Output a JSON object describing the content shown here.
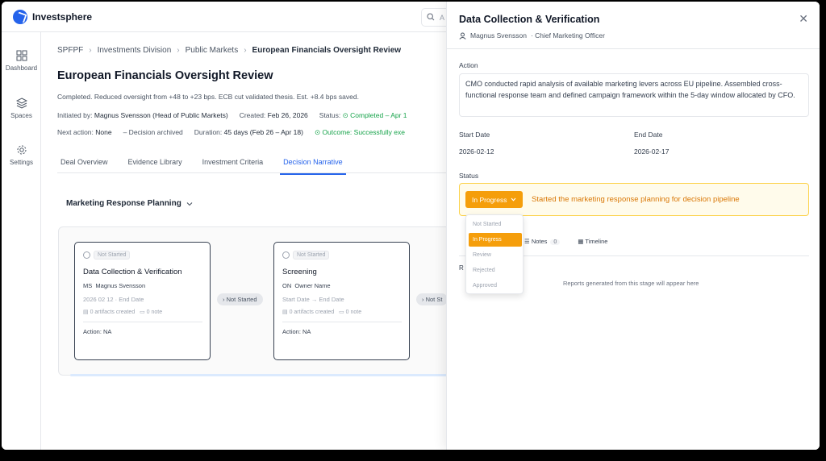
{
  "app": {
    "name": "Investsphere",
    "search_placeholder": "A"
  },
  "sidebar": {
    "items": [
      {
        "label": "Dashboard",
        "icon": "grid-icon"
      },
      {
        "label": "Spaces",
        "icon": "layers-icon"
      },
      {
        "label": "Settings",
        "icon": "gear-icon"
      }
    ]
  },
  "breadcrumb": [
    "SPFPF",
    "Investments Division",
    "Public Markets",
    "European Financials Oversight Review"
  ],
  "review": {
    "title": "European Financials Oversight Review",
    "summary": "Completed. Reduced oversight from +48 to +23 bps. ECB cut validated thesis. Est. +8.4 bps saved.",
    "initiated_label": "Initiated by:",
    "initiated_value": "Magnus Svensson (Head of Public Markets)",
    "created_label": "Created:",
    "created_value": "Feb 26, 2026",
    "status_label": "Status:",
    "status_value": "Completed – Apr 1",
    "next_action_label": "Next action:",
    "next_action_value": "None",
    "decision_value": "–  Decision archived",
    "duration_label": "Duration:",
    "duration_value": "45 days (Feb 26 – Apr 18)",
    "outcome_value": "Outcome: Successfully exe"
  },
  "tabs": [
    "Deal Overview",
    "Evidence Library",
    "Investment Criteria",
    "Decision Narrative"
  ],
  "stage_selector": "Marketing Response Planning",
  "cards": [
    {
      "status": "Not Started",
      "title": "Data Collection & Verification",
      "owner_initials": "MS",
      "owner": "Magnus Svensson",
      "dates": "2026  02  12   ·  End Date",
      "artifacts": "0 artifacts created",
      "notes": "0 note",
      "action": "Action: NA"
    },
    {
      "status": "Not Started",
      "title": "Screening",
      "owner_initials": "ON",
      "owner": "Owner Name",
      "dates": "Start Date  →  End Date",
      "artifacts": "0 artifacts created",
      "notes": "0 note",
      "action": "Action: NA"
    }
  ],
  "connectors": [
    "Not Started",
    "Not St"
  ],
  "panel": {
    "title": "Data Collection & Verification",
    "owner": "Magnus Svensson",
    "owner_role": "·  Chief Marketing Officer",
    "action_label": "Action",
    "action_text": "CMO conducted rapid analysis of available marketing levers across EU pipeline. Assembled cross-functional response team and defined campaign framework within the 5-day window allocated by CFO.",
    "start_label": "Start Date",
    "start_value": "2026-02-12",
    "end_label": "End Date",
    "end_value": "2026-02-17",
    "status_label": "Status",
    "status_value": "In Progress",
    "status_message": "Started the marketing response planning for decision pipeline",
    "status_options": [
      "Not Started",
      "In Progress",
      "Review",
      "Rejected",
      "Approved"
    ],
    "sub_tabs": {
      "notes": "Notes",
      "notes_count": "0",
      "timeline": "Timeline"
    },
    "reports_fragment": "R",
    "reports_empty": "Reports generated from this stage will appear here"
  },
  "colors": {
    "accent": "#2563eb",
    "status_in_progress": "#f59e0b",
    "success": "#16a34a"
  }
}
